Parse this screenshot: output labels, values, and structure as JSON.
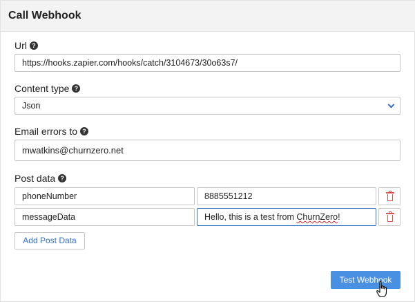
{
  "header": {
    "title": "Call Webhook"
  },
  "url": {
    "label": "Url",
    "help_icon": "question-circle-icon",
    "value": "https://hooks.zapier.com/hooks/catch/3104673/30o63s7/"
  },
  "content_type": {
    "label": "Content type",
    "help_icon": "question-circle-icon",
    "selected": "Json"
  },
  "email_errors": {
    "label": "Email errors to",
    "help_icon": "question-circle-icon",
    "value": "mwatkins@churnzero.net"
  },
  "post_data": {
    "label": "Post data",
    "help_icon": "question-circle-icon",
    "rows": [
      {
        "key": "phoneNumber",
        "value": "8885551212"
      },
      {
        "key": "messageData",
        "value_prefix": "Hello, this is a test from ",
        "value_misspelled": "ChurnZero",
        "value_suffix": "!"
      }
    ],
    "add_label": "Add Post Data"
  },
  "actions": {
    "test_label": "Test Webhook"
  },
  "colors": {
    "accent": "#4a90e2",
    "link": "#2f6fcb",
    "danger": "#d9534f",
    "header_bg": "#f3f3f3"
  }
}
